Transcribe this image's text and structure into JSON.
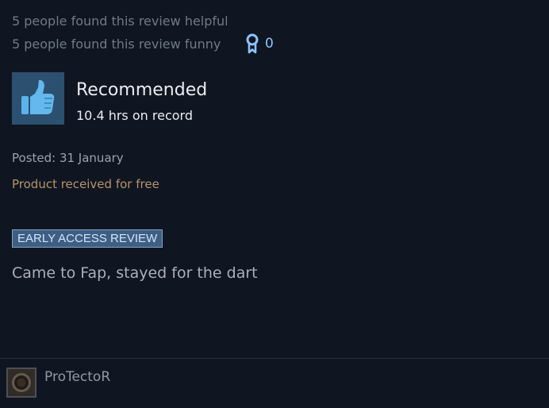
{
  "review": {
    "helpful_text": "5 people found this review helpful",
    "funny_text": "5 people found this review funny",
    "award_icon": "award-ribbon-icon",
    "award_count": "0",
    "thumb_icon": "thumbs-up-icon",
    "recommendation": "Recommended",
    "hours": "10.4 hrs on record",
    "posted": "Posted: 31 January",
    "received_free": "Product received for free",
    "early_access_badge": "EARLY ACCESS REVIEW",
    "body": "Came to Fap, stayed for the dart"
  },
  "author": {
    "name": "ProTectoR"
  },
  "colors": {
    "background": "#0f1621",
    "accent_blue": "#8ec3ff",
    "free_label": "#b7936b",
    "badge_background": "#3f5f82"
  }
}
